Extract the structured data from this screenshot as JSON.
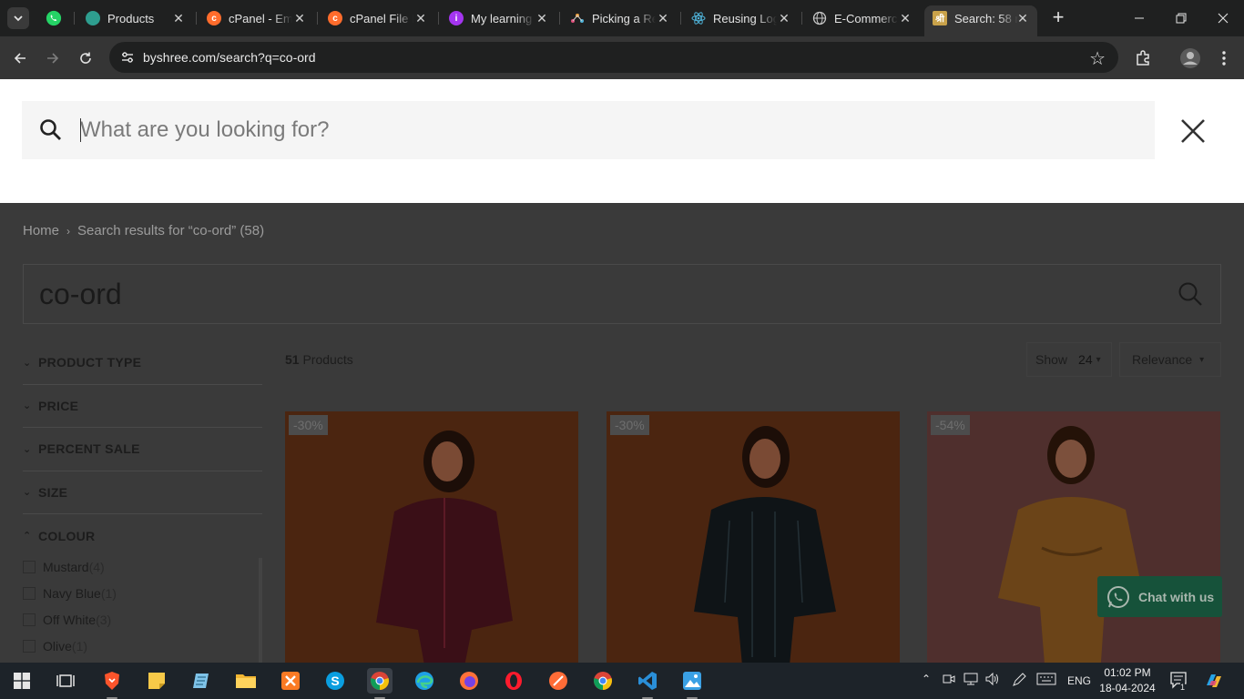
{
  "browser": {
    "tabs": [
      {
        "title": "",
        "favicon": "whatsapp-icon",
        "color": "#25d366"
      },
      {
        "title": "Products",
        "favicon": "product-app-icon",
        "color": "#3bb6a6"
      },
      {
        "title": "cPanel - Em",
        "favicon": "cpanel-icon",
        "color": "#ff6c2c"
      },
      {
        "title": "cPanel File I",
        "favicon": "cpanel-icon",
        "color": "#ff6c2c"
      },
      {
        "title": "My learning",
        "favicon": "learning-icon",
        "color": "#a435f0"
      },
      {
        "title": "Picking a Re",
        "favicon": "graph-icon",
        "color": "#e04e7a"
      },
      {
        "title": "Reusing Log",
        "favicon": "react-icon",
        "color": "#4fb3d9"
      },
      {
        "title": "E-Commerc",
        "favicon": "globe-icon",
        "color": "#c8c8c8"
      },
      {
        "title": "Search: 58 r",
        "favicon": "byshree-icon",
        "color": "#c9a24a"
      }
    ],
    "url": "byshree.com/search?q=co-ord"
  },
  "search_panel": {
    "placeholder": "What are you looking for?"
  },
  "breadcrumb": {
    "home": "Home",
    "current": "Search results for “co-ord” (58)"
  },
  "query": "co-ord",
  "filters": [
    {
      "label": "PRODUCT TYPE",
      "open": false
    },
    {
      "label": "PRICE",
      "open": false
    },
    {
      "label": "PERCENT SALE",
      "open": false
    },
    {
      "label": "SIZE",
      "open": false
    },
    {
      "label": "COLOUR",
      "open": true
    }
  ],
  "colours": [
    {
      "name": "Mustard",
      "count": "(4)"
    },
    {
      "name": "Navy Blue",
      "count": "(1)"
    },
    {
      "name": "Off White",
      "count": "(3)"
    },
    {
      "name": "Olive",
      "count": "(1)"
    }
  ],
  "results": {
    "count": "51",
    "count_label": "Products",
    "show_label": "Show",
    "show_value": "24",
    "sort_label": "Relevance"
  },
  "products": [
    {
      "badge": "-30%",
      "bg": "#4a2310",
      "dress": "#3d1018"
    },
    {
      "badge": "-30%",
      "bg": "#4a2310",
      "dress": "#101416"
    },
    {
      "badge": "-54%",
      "bg": "#4e2e2c",
      "dress": "#6a4318"
    }
  ],
  "chat": {
    "label": "Chat with us"
  },
  "taskbar": {
    "language": "ENG",
    "time": "01:02 PM",
    "date": "18-04-2024",
    "notification_count": "1"
  }
}
